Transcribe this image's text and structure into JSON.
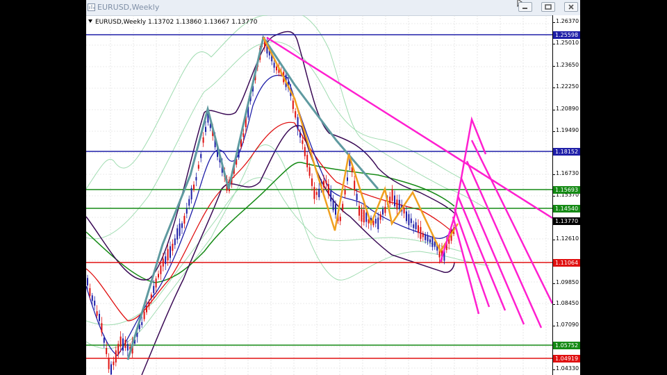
{
  "window": {
    "title": "EURUSD,Weekly",
    "symbol_info": "EURUSD,Weekly  1.13702 1.13860 1.13667 1.13770"
  },
  "colors": {
    "blue_line": "#1f1fa8",
    "green_line": "#158a15",
    "red_line": "#e01010",
    "black_label": "#000000",
    "magenta": "#ff1fd0",
    "orange": "#f0a020",
    "teal": "#5f9aa0"
  },
  "axis": {
    "ticks": [
      "1.26370",
      "1.25010",
      "1.23650",
      "1.22250",
      "1.20890",
      "1.19490",
      "1.16730",
      "1.15370",
      "1.12610",
      "1.09850",
      "1.08450",
      "1.07090",
      "1.04330"
    ]
  },
  "price_labels": [
    {
      "text": "1.25598",
      "color": "#1f1fa8"
    },
    {
      "text": "1.18152",
      "color": "#1f1fa8"
    },
    {
      "text": "1.15693",
      "color": "#158a15"
    },
    {
      "text": "1.14540",
      "color": "#158a15"
    },
    {
      "text": "1.13770",
      "color": "#000000"
    },
    {
      "text": "1.11064",
      "color": "#e01010"
    },
    {
      "text": "1.05752",
      "color": "#158a15"
    },
    {
      "text": "1.04919",
      "color": "#e01010"
    }
  ],
  "icons": [
    "chart-window-icon",
    "minimize-icon",
    "maximize-icon",
    "close-icon",
    "cursor-icon"
  ]
}
